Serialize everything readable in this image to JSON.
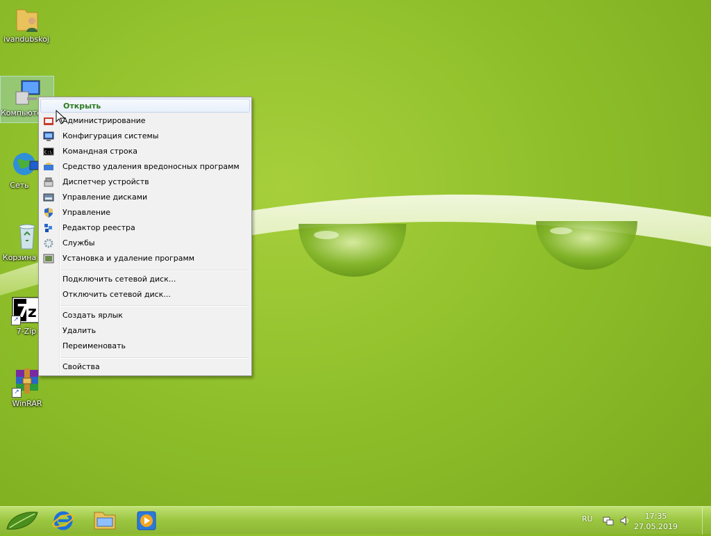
{
  "desktop": {
    "icons": [
      {
        "label": "ivandubskoj",
        "icon": "user-folder-icon"
      },
      {
        "label": "Компьютер",
        "icon": "computer-icon"
      },
      {
        "label": "Сеть",
        "icon": "network-icon"
      },
      {
        "label": "Корзина",
        "icon": "recycle-bin-icon"
      },
      {
        "label": "7-Zip",
        "icon": "7zip-icon"
      },
      {
        "label": "WinRAR",
        "icon": "winrar-icon"
      }
    ],
    "accent": "#8fc02b"
  },
  "context_menu": {
    "items": [
      {
        "label": "Открыть",
        "default": true
      },
      {
        "label": "Администрирование",
        "icon": "admin-tools-icon"
      },
      {
        "label": "Конфигурация системы",
        "icon": "system-config-icon"
      },
      {
        "label": "Командная строка",
        "icon": "cmd-icon"
      },
      {
        "label": "Средство удаления вредоносных программ",
        "icon": "malware-removal-icon"
      },
      {
        "label": "Диспетчер устройств",
        "icon": "device-manager-icon"
      },
      {
        "label": "Управление дисками",
        "icon": "disk-management-icon"
      },
      {
        "label": "Управление",
        "icon": "shield-icon"
      },
      {
        "label": "Редактор реестра",
        "icon": "registry-editor-icon"
      },
      {
        "label": "Службы",
        "icon": "services-gear-icon"
      },
      {
        "label": "Установка и удаление программ",
        "icon": "programs-icon"
      },
      {
        "label": "Подключить сетевой диск..."
      },
      {
        "label": "Отключить сетевой диск..."
      },
      {
        "label": "Создать ярлык"
      },
      {
        "label": "Удалить"
      },
      {
        "label": "Переименовать"
      },
      {
        "label": "Свойства"
      }
    ]
  },
  "taskbar": {
    "pinned": [
      "start-button-icon",
      "internet-explorer-icon",
      "file-explorer-icon",
      "media-player-icon"
    ],
    "language": "RU",
    "time": "17:35",
    "date": "27.05.2019"
  }
}
